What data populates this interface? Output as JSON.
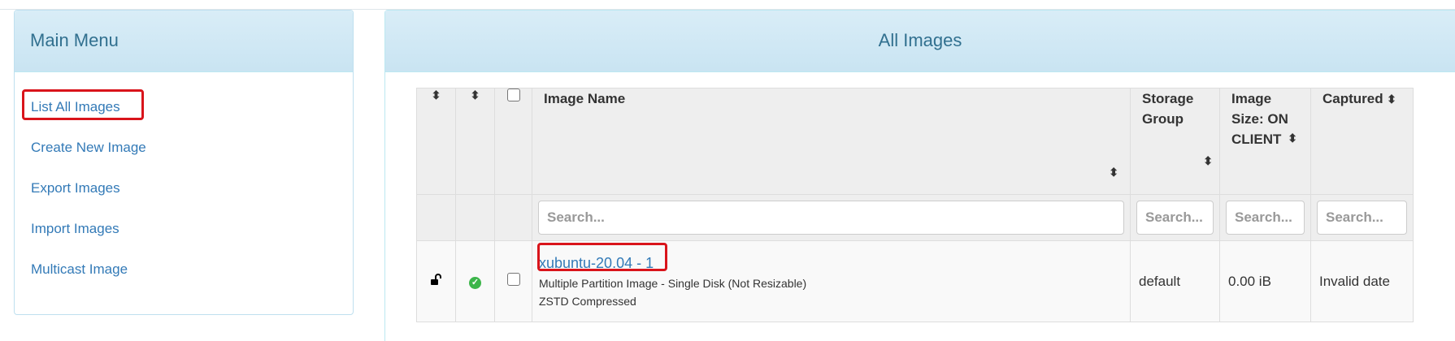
{
  "sidebar": {
    "title": "Main Menu",
    "items": [
      {
        "label": "List All Images"
      },
      {
        "label": "Create New Image"
      },
      {
        "label": "Export Images"
      },
      {
        "label": "Import Images"
      },
      {
        "label": "Multicast Image"
      }
    ]
  },
  "main": {
    "title": "All Images",
    "columns": [
      {
        "label": ""
      },
      {
        "label": ""
      },
      {
        "label": ""
      },
      {
        "label": "Image Name"
      },
      {
        "label": "Storage Group"
      },
      {
        "label": "Image Size: ON CLIENT"
      },
      {
        "label": "Captured"
      }
    ],
    "search_placeholder": "Search...",
    "rows": [
      {
        "name": "xubuntu-20.04 - 1",
        "description": "Multiple Partition Image - Single Disk (Not Resizable)",
        "compression": "ZSTD Compressed",
        "storage_group": "default",
        "size": "0.00 iB",
        "captured": "Invalid date"
      }
    ]
  },
  "icons": {
    "sort": "sort-updown-icon",
    "lock": "unlocked-padlock-icon",
    "status": "check-circle-icon"
  },
  "colors": {
    "link": "#337ab7",
    "panel_header": "#d9edf7",
    "highlight": "#d9141b",
    "status_ok": "#3cb54a"
  }
}
